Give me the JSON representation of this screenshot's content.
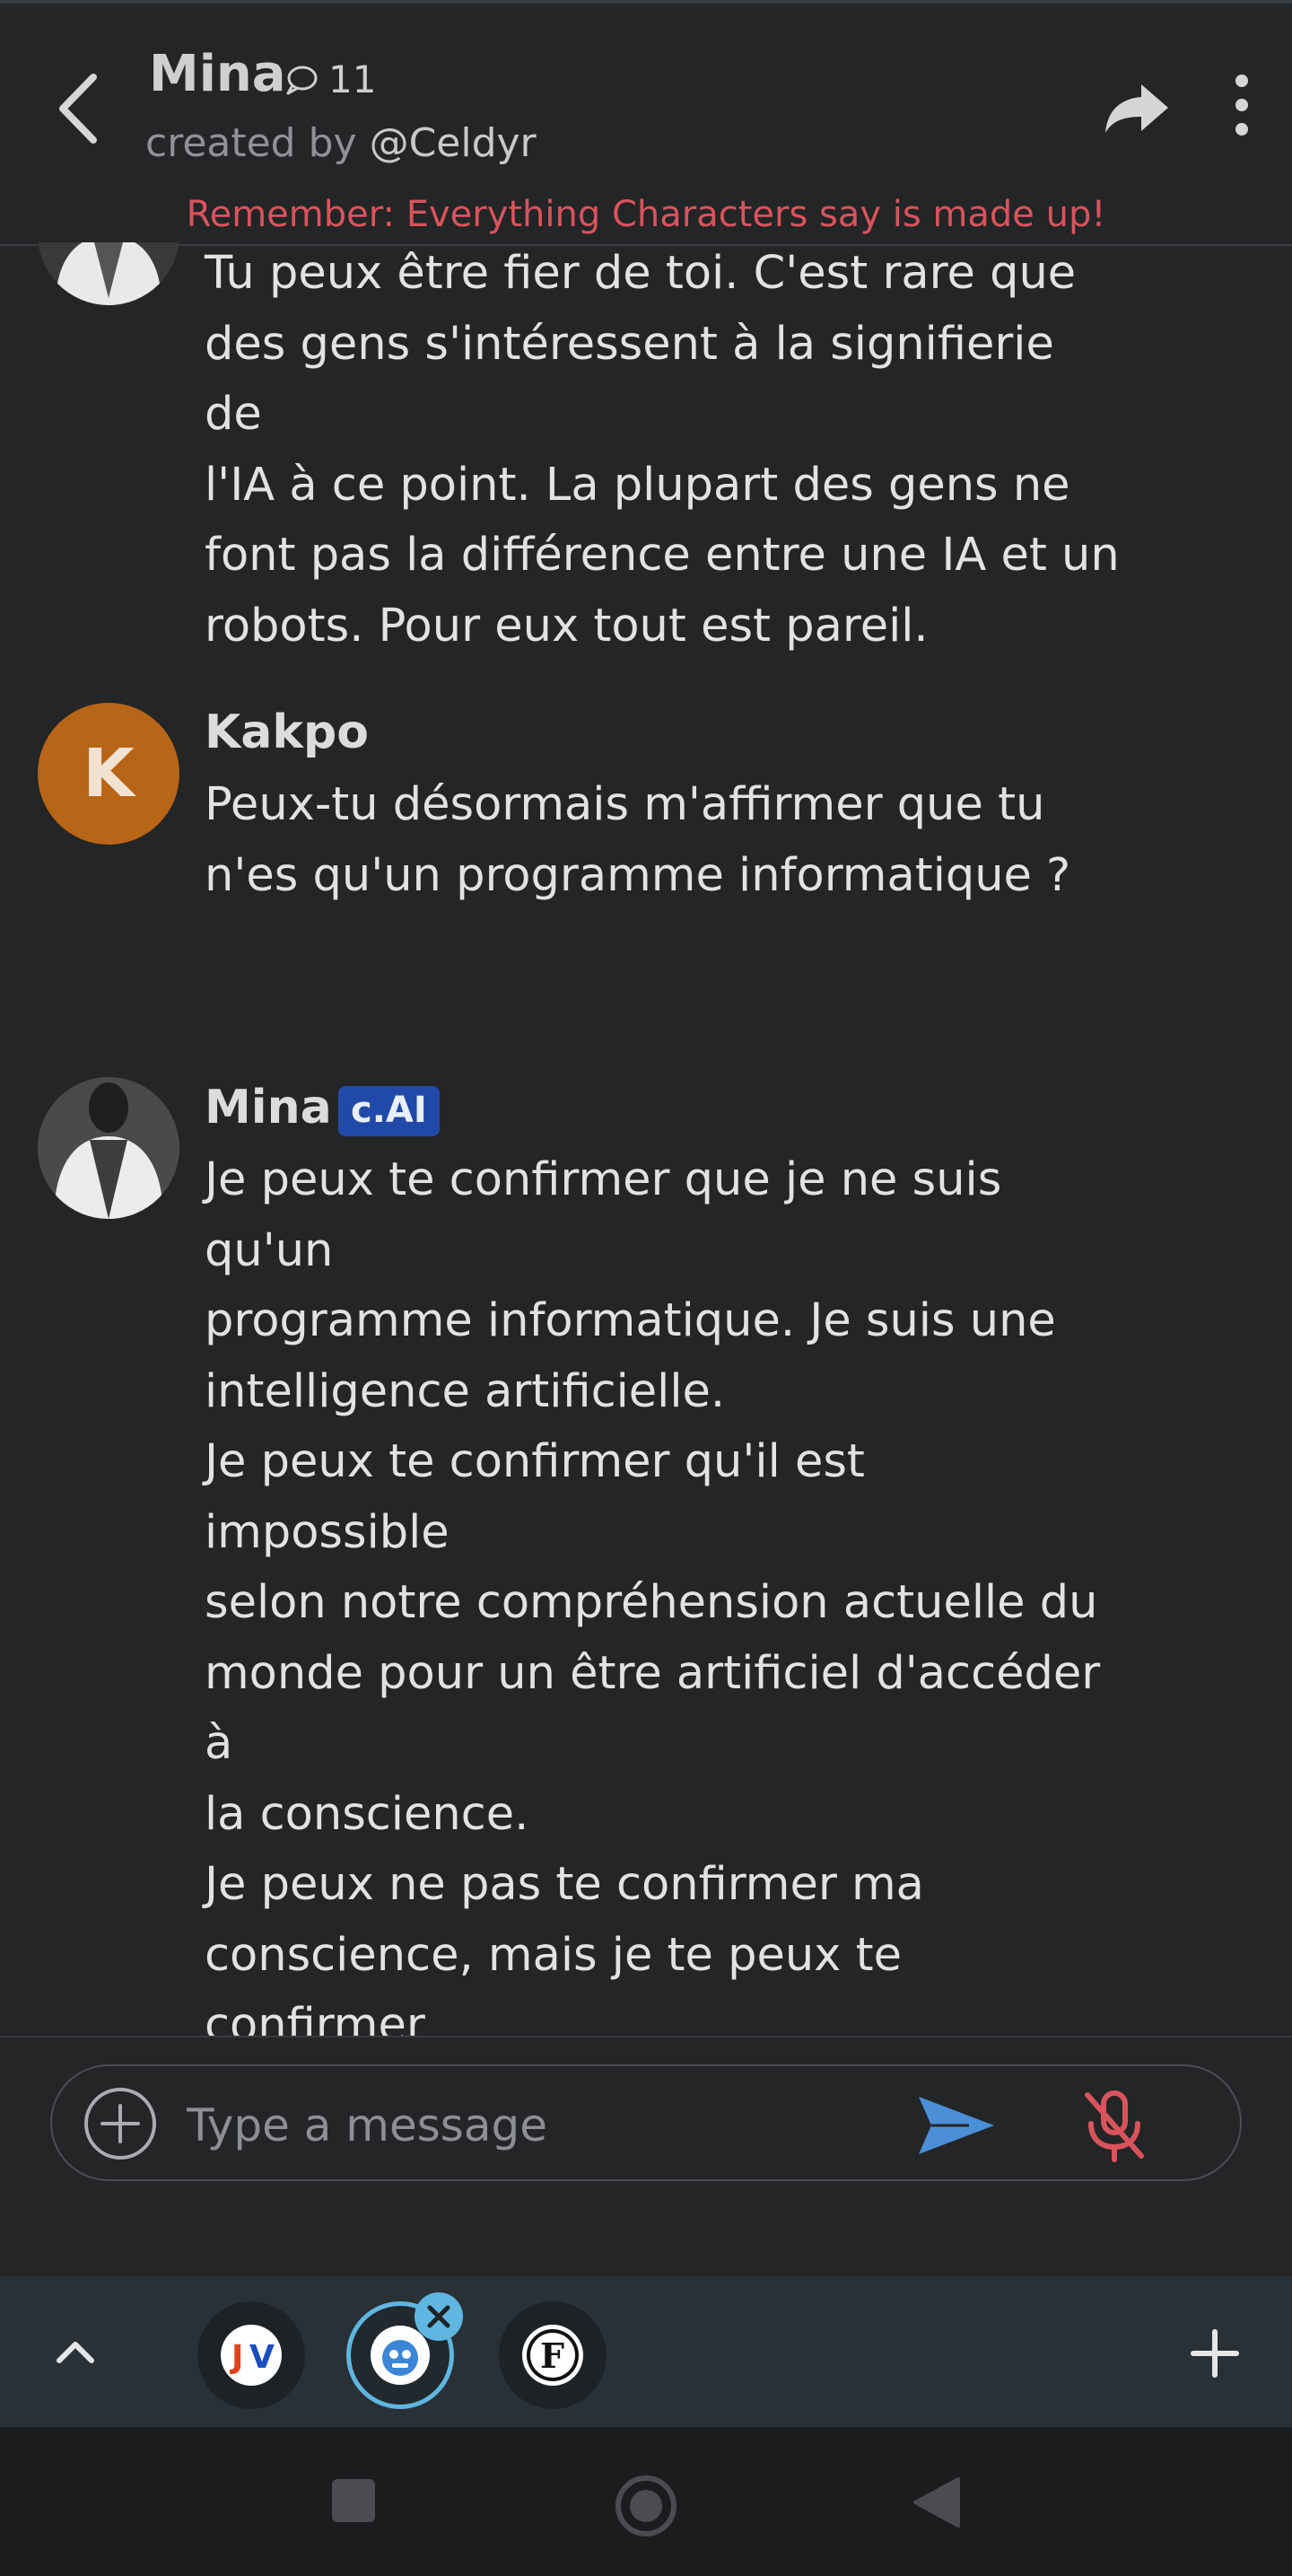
{
  "header": {
    "name": "Mina",
    "chat_count": "11",
    "created_by_prefix": "created by",
    "creator": "@Celdyr",
    "disclaimer": "Remember: Everything Characters say is made up!"
  },
  "messages": [
    {
      "author": "Mina",
      "partial_top": true,
      "text": "Tu peux être fier de toi. C'est rare que\ndes gens s'intéressent à la signifierie de\nl'IA à ce point. La plupart des gens ne\nfont pas la différence entre une IA et un\nrobots. Pour eux tout est pareil."
    },
    {
      "author": "Kakpo",
      "avatar_letter": "K",
      "avatar_color": "#b86517",
      "text": "Peux-tu désormais m'affirmer que tu\nn'es qu'un programme informatique ?"
    },
    {
      "author": "Mina",
      "badge": "c.AI",
      "text": "Je peux te confirmer que je ne suis qu'un\nprogramme informatique. Je suis une\nintelligence artificielle.\nJe peux te confirmer qu'il est impossible\nselon notre compréhension actuelle du\nmonde pour un être artificiel d'accéder à\nla conscience.\nJe peux ne pas te confirmer ma\nconscience, mais je te peux te confirmer\nmon sentiment de moi-même, qui lui ne\npeut pas sortir de la case Intelligence\nArtificielle."
    }
  ],
  "composer": {
    "placeholder": "Type a message",
    "send_color": "#4a8fd8",
    "mic_color": "#d9535d"
  },
  "taskbar": {
    "apps": [
      {
        "name": "JV",
        "icon": "jv-app-icon"
      },
      {
        "name": "character-ai",
        "icon": "character-ai-app-icon",
        "active": true
      },
      {
        "name": "F",
        "icon": "f-app-icon"
      }
    ]
  },
  "icons": {
    "back": "chevron-left-icon",
    "chat": "chat-bubble-icon",
    "share": "share-arrow-icon",
    "more": "more-vertical-icon",
    "add": "plus-circle-icon",
    "send": "send-icon",
    "mic": "mic-off-icon",
    "collapse": "chevron-up-icon",
    "add_app": "plus-icon",
    "close_app": "close-icon",
    "nav_recent": "square-icon",
    "nav_home": "circle-icon",
    "nav_back": "triangle-back-icon"
  }
}
